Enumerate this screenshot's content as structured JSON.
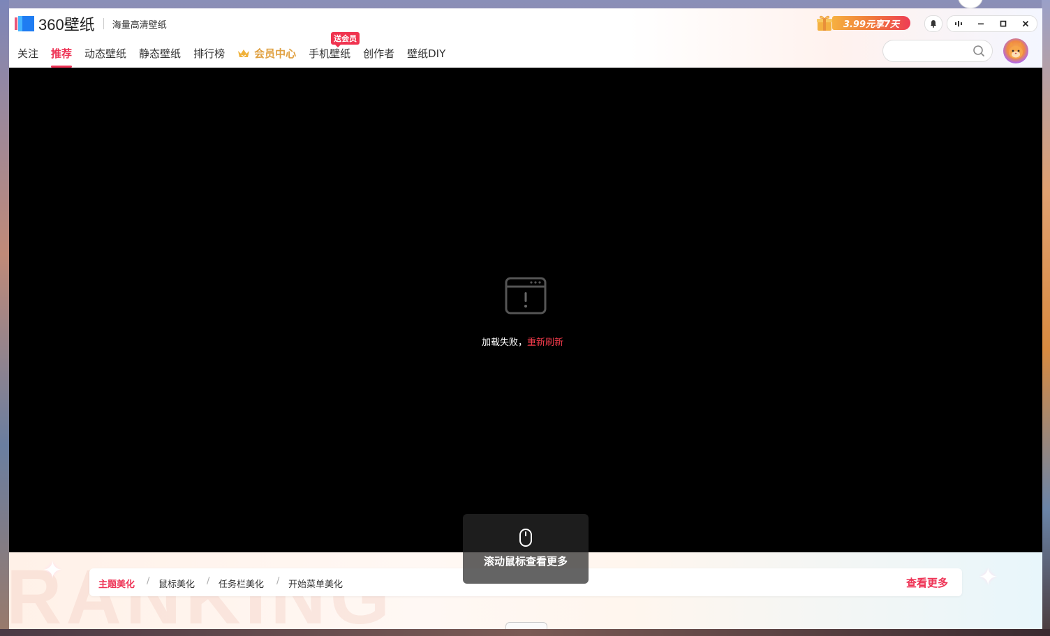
{
  "app": {
    "logo_text": "360壁纸",
    "slogan": "海量高清壁纸"
  },
  "nav": {
    "items": [
      {
        "label": "关注"
      },
      {
        "label": "推荐"
      },
      {
        "label": "动态壁纸"
      },
      {
        "label": "静态壁纸"
      },
      {
        "label": "排行榜"
      },
      {
        "label": "会员中心"
      },
      {
        "label": "手机壁纸",
        "badge": "送会员"
      },
      {
        "label": "创作者"
      },
      {
        "label": "壁纸DIY"
      }
    ],
    "active_index": 1
  },
  "promo": {
    "text": "3.99元享7天",
    "icon": "gift-icon"
  },
  "window_controls": {
    "bell_icon": "bell-icon",
    "skin_icon": "equalizer-icon",
    "minimize_icon": "minimize-icon",
    "maximize_icon": "maximize-icon",
    "close_icon": "close-icon"
  },
  "search": {
    "placeholder": "",
    "icon": "search-icon"
  },
  "error": {
    "message": "加载失败，",
    "retry_label": "重新刷新",
    "icon": "browser-warning-icon"
  },
  "bottom": {
    "watermark": "RANKING",
    "tabs": [
      {
        "label": "主题美化"
      },
      {
        "label": "鼠标美化"
      },
      {
        "label": "任务栏美化"
      },
      {
        "label": "开始菜单美化"
      }
    ],
    "separator": "/",
    "more_label": "查看更多"
  },
  "scroll_tip": {
    "text": "滚动鼠标查看更多",
    "icon": "mouse-icon"
  },
  "colors": {
    "accent": "#ee3355",
    "vip": "#e0a040",
    "content_bg": "#000000"
  }
}
